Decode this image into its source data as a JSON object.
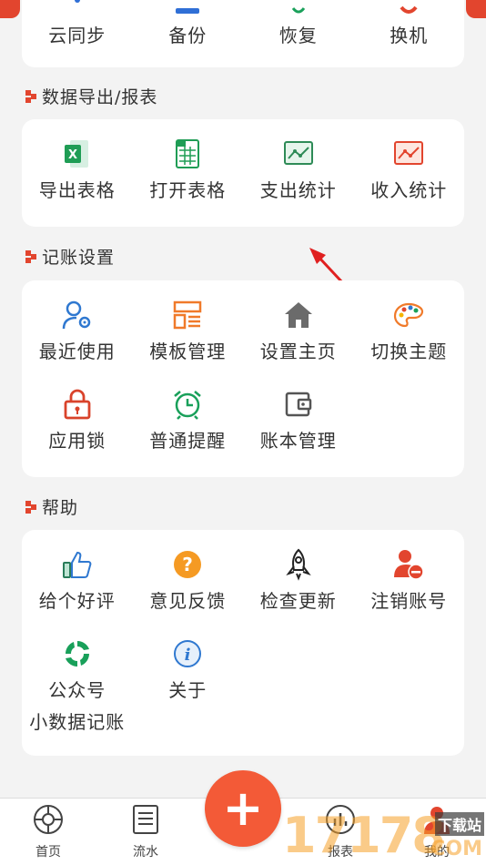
{
  "top_row": {
    "items": [
      {
        "label": "云同步",
        "icon": "cloud-sync-icon"
      },
      {
        "label": "备份",
        "icon": "backup-icon"
      },
      {
        "label": "恢复",
        "icon": "restore-icon"
      },
      {
        "label": "换机",
        "icon": "switch-device-icon"
      }
    ]
  },
  "sections": [
    {
      "title": "数据导出/报表",
      "items": [
        {
          "label": "导出表格",
          "icon": "excel-icon"
        },
        {
          "label": "打开表格",
          "icon": "spreadsheet-icon"
        },
        {
          "label": "支出统计",
          "icon": "expense-chart-icon"
        },
        {
          "label": "收入统计",
          "icon": "income-chart-icon"
        }
      ]
    },
    {
      "title": "记账设置",
      "items": [
        {
          "label": "最近使用",
          "icon": "user-settings-icon"
        },
        {
          "label": "模板管理",
          "icon": "template-icon"
        },
        {
          "label": "设置主页",
          "icon": "home-icon"
        },
        {
          "label": "切换主题",
          "icon": "palette-icon"
        },
        {
          "label": "应用锁",
          "icon": "lock-icon"
        },
        {
          "label": "普通提醒",
          "icon": "alarm-clock-icon"
        },
        {
          "label": "账本管理",
          "icon": "wallet-icon"
        }
      ]
    },
    {
      "title": "帮助",
      "items": [
        {
          "label": "给个好评",
          "icon": "thumbs-up-icon"
        },
        {
          "label": "意见反馈",
          "icon": "question-icon"
        },
        {
          "label": "检查更新",
          "icon": "rocket-icon"
        },
        {
          "label": "注销账号",
          "icon": "user-remove-icon"
        },
        {
          "label": "公众号",
          "label2": "小数据记账",
          "icon": "official-account-icon"
        },
        {
          "label": "关于",
          "icon": "info-icon"
        }
      ]
    }
  ],
  "tabbar": {
    "tabs": [
      {
        "label": "首页",
        "icon": "home-tab-icon"
      },
      {
        "label": "流水",
        "icon": "list-tab-icon"
      },
      {
        "label": "报表",
        "icon": "chart-tab-icon"
      },
      {
        "label": "我的",
        "icon": "profile-tab-icon"
      }
    ],
    "fab_symbol": "+"
  },
  "watermark": {
    "text": "17178",
    "sub": "下载站",
    "domain": "COM"
  },
  "colors": {
    "accent": "#f35a37",
    "section_marker": "#e2452e",
    "arrow": "#e02020"
  }
}
